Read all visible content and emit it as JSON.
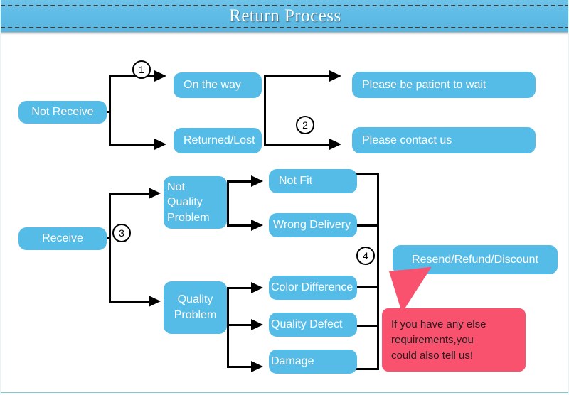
{
  "header": {
    "title": "Return Process"
  },
  "flow": {
    "nodes": {
      "not_receive": "Not Receive",
      "on_the_way": "On the way",
      "returned_lost": "Returned/Lost",
      "please_wait": "Please be patient to wait",
      "please_contact": "Please contact us",
      "receive": "Receive",
      "not_quality_problem": "Not\nQuality\nProblem",
      "quality_problem": "Quality\nProblem",
      "not_fit": "Not Fit",
      "wrong_delivery": "Wrong Delivery",
      "color_difference": "Color Difference",
      "quality_defect": "Quality Defect",
      "damage": "Damage",
      "resend_refund_discount": "Resend/Refund/Discount"
    },
    "steps": {
      "one": "1",
      "two": "2",
      "three": "3",
      "four": "4"
    }
  },
  "callout": {
    "text": "If you have any else\nrequirements,you\ncould also tell us!"
  },
  "colors": {
    "banner_blue": "#5ebce6",
    "node_blue": "#55bce7",
    "callout_pink": "#f9526f",
    "line_black": "#000000",
    "footer_rule": "#7fc9d4"
  }
}
